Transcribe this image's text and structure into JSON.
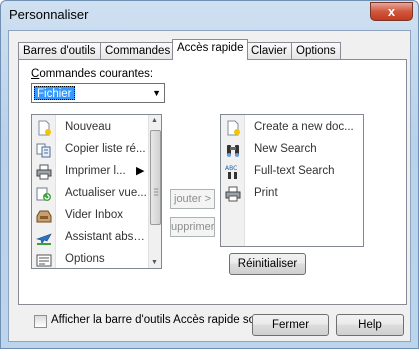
{
  "window": {
    "title": "Personnaliser",
    "close_glyph": "x"
  },
  "tabs": [
    {
      "label": "Barres d'outils"
    },
    {
      "label": "Commandes"
    },
    {
      "label": "Accès rapide"
    },
    {
      "label": "Clavier"
    },
    {
      "label": "Options"
    }
  ],
  "commands": {
    "label_prefix": "C",
    "label_rest": "ommandes courantes:",
    "selected": "Fichier"
  },
  "left_list": [
    {
      "label": "Nouveau",
      "icon": "new-document-icon"
    },
    {
      "label": "Copier liste ré...",
      "icon": "copy-list-icon"
    },
    {
      "label": "Imprimer l...",
      "icon": "printer-icon"
    },
    {
      "label": "Actualiser vue...",
      "icon": "refresh-view-icon"
    },
    {
      "label": "Vider Inbox",
      "icon": "inbox-tray-icon"
    },
    {
      "label": "Assistant abse...",
      "icon": "airplane-icon"
    },
    {
      "label": "Options",
      "icon": "options-icon"
    }
  ],
  "buttons": {
    "add": "jouter >",
    "remove": "upprimer",
    "reset": "Réinitialiser",
    "close": "Fermer",
    "help": "Help"
  },
  "right_list": [
    {
      "label": "Create a new doc...",
      "icon": "new-document-icon"
    },
    {
      "label": "New Search",
      "icon": "binoculars-icon"
    },
    {
      "label": "Full-text Search",
      "icon": "abc-search-icon"
    },
    {
      "label": "Print",
      "icon": "printer-icon"
    }
  ],
  "checkbox": {
    "label": "Afficher la barre d'outils Accès rapide sous le ruban",
    "checked": false
  }
}
